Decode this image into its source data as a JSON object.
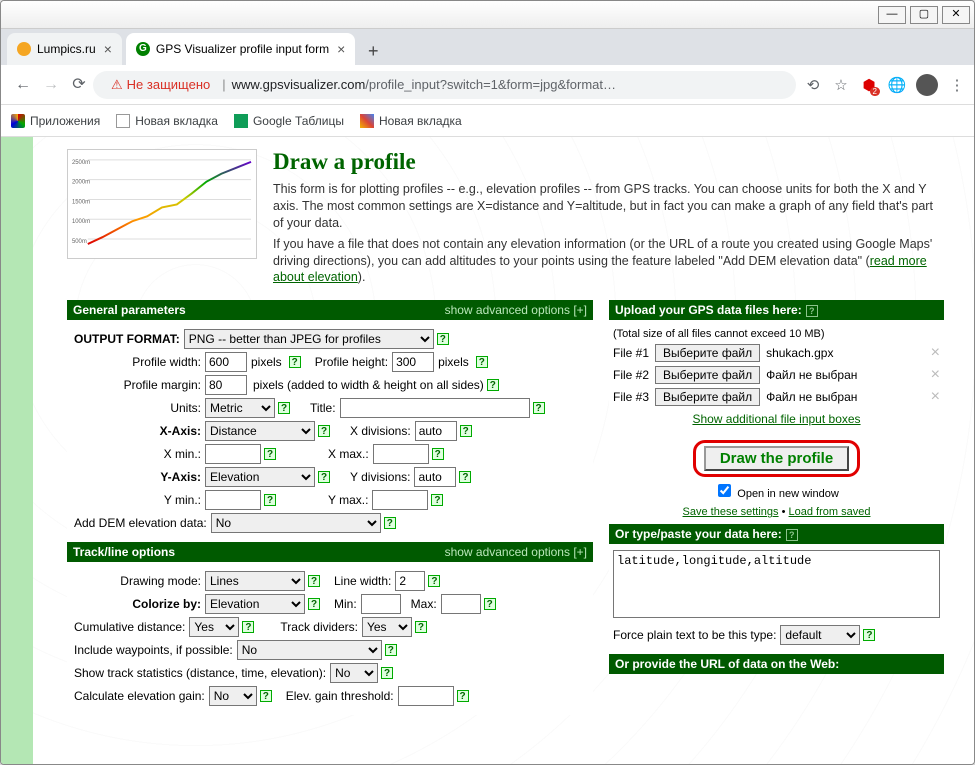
{
  "window": {
    "min": "—",
    "max": "▢",
    "close": "✕"
  },
  "tabs": [
    {
      "title": "Lumpics.ru",
      "favicon": "#f5a623",
      "active": false
    },
    {
      "title": "GPS Visualizer profile input form",
      "favicon_text": "G",
      "favicon_bg": "#008000",
      "active": true
    }
  ],
  "addressbar": {
    "security_text": "Не защищено",
    "host": "www.gpsvisualizer.com",
    "path": "/profile_input?switch=1&form=jpg&format…"
  },
  "bookmarks": [
    {
      "label": "Приложения",
      "icon": "apps"
    },
    {
      "label": "Новая вкладка",
      "icon": "page"
    },
    {
      "label": "Google Таблицы",
      "icon": "sheets"
    },
    {
      "label": "Новая вкладка",
      "icon": "photo"
    }
  ],
  "page": {
    "title": "Draw a profile",
    "p1": "This form is for plotting profiles -- e.g., elevation profiles -- from GPS tracks. You can choose units for both the X and Y axis. The most common settings are X=distance and Y=altitude, but in fact you can make a graph of any field that's part of your data.",
    "p2a": "If you have a file that does not contain any elevation information (or the URL of a route you created using Google Maps' driving directions), you can add altitudes to your points using the feature labeled \"Add DEM elevation data\" (",
    "p2link": "read more about elevation",
    "p2b": ")."
  },
  "general": {
    "header": "General parameters",
    "adv": "show advanced options [+]",
    "output_format_label": "OUTPUT FORMAT:",
    "output_format": "PNG -- better than JPEG for profiles",
    "width_label": "Profile width:",
    "width": "600",
    "pixels": "pixels",
    "height_label": "Profile height:",
    "height": "300",
    "margin_label": "Profile margin:",
    "margin": "80",
    "margin_note": "pixels (added to width & height on all sides)",
    "units_label": "Units:",
    "units": "Metric",
    "title_label": "Title:",
    "title": "",
    "xaxis_label": "X-Axis:",
    "xaxis": "Distance",
    "xdiv_label": "X divisions:",
    "xdiv": "auto",
    "xmin_label": "X min.:",
    "xmin": "",
    "xmax_label": "X max.:",
    "xmax": "",
    "yaxis_label": "Y-Axis:",
    "yaxis": "Elevation",
    "ydiv_label": "Y divisions:",
    "ydiv": "auto",
    "ymin_label": "Y min.:",
    "ymin": "",
    "ymax_label": "Y max.:",
    "ymax": "",
    "dem_label": "Add DEM elevation data:",
    "dem": "No"
  },
  "track": {
    "header": "Track/line options",
    "adv": "show advanced options [+]",
    "mode_label": "Drawing mode:",
    "mode": "Lines",
    "lwidth_label": "Line width:",
    "lwidth": "2",
    "colorize_label": "Colorize by:",
    "colorize": "Elevation",
    "min_label": "Min:",
    "min": "",
    "max_label": "Max:",
    "max": "",
    "cumdist_label": "Cumulative distance:",
    "cumdist": "Yes",
    "divider_label": "Track dividers:",
    "divider": "Yes",
    "waypoints_label": "Include waypoints, if possible:",
    "waypoints": "No",
    "stats_label": "Show track statistics (distance, time, elevation):",
    "stats": "No",
    "gain_label": "Calculate elevation gain:",
    "gain": "No",
    "thresh_label": "Elev. gain threshold:",
    "thresh": ""
  },
  "upload": {
    "header": "Upload your GPS data files here:",
    "note": "(Total size of all files cannot exceed 10 MB)",
    "files": [
      {
        "label": "File #1",
        "btn": "Выберите файл",
        "name": "shukach.gpx",
        "has": true
      },
      {
        "label": "File #2",
        "btn": "Выберите файл",
        "name": "Файл не выбран",
        "has": false
      },
      {
        "label": "File #3",
        "btn": "Выберите файл",
        "name": "Файл не выбран",
        "has": false
      }
    ],
    "more_link": "Show additional file input boxes",
    "draw_button": "Draw the profile",
    "newwin": "Open in new window",
    "save_link": "Save these settings",
    "load_link": "Load from saved"
  },
  "paste": {
    "header": "Or type/paste your data here:",
    "value": "latitude,longitude,altitude",
    "force_label": "Force plain text to be this type:",
    "force": "default"
  },
  "urlweb": {
    "header": "Or provide the URL of data on the Web:"
  },
  "chart_data": {
    "type": "line",
    "title": "",
    "xlabel": "",
    "ylabel": "",
    "x": [
      0,
      2,
      4,
      6,
      8,
      10,
      12,
      14,
      16,
      18,
      20
    ],
    "values": [
      500,
      700,
      900,
      1100,
      1200,
      1400,
      1450,
      1700,
      2000,
      2200,
      2300
    ],
    "ylim": [
      500,
      2500
    ]
  }
}
